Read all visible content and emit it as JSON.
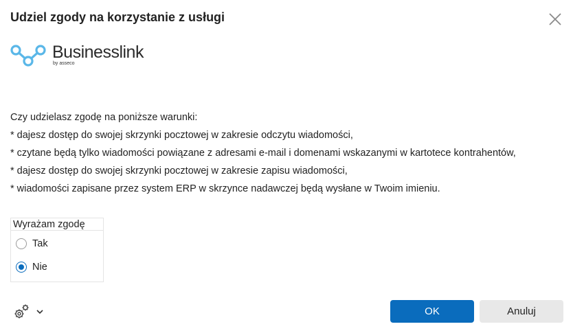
{
  "dialog": {
    "title": "Udziel zgody na korzystanie z usługi",
    "close_icon": "close-icon"
  },
  "logo": {
    "name": "Businesslink",
    "sub": "by asseco",
    "accent_color": "#5ab7e8"
  },
  "terms": {
    "intro": "Czy udzielasz zgodę na poniższe warunki:",
    "items": [
      "* dajesz dostęp do swojej skrzynki pocztowej w zakresie odczytu wiadomości,",
      "* czytane będą tylko wiadomości powiązane z adresami e-mail i domenami wskazanymi w kartotece kontrahentów,",
      "* dajesz dostęp do swojej skrzynki pocztowej w zakresie zapisu wiadomości,",
      "* wiadomości zapisane przez system ERP w skrzynce nadawczej będą wysłane w Twoim imieniu."
    ]
  },
  "consent": {
    "legend": "Wyrażam zgodę",
    "options": [
      {
        "label": "Tak",
        "checked": false
      },
      {
        "label": "Nie",
        "checked": true
      }
    ]
  },
  "footer": {
    "settings_icon": "gears-icon",
    "chevron_icon": "chevron-down-icon",
    "ok_label": "OK",
    "cancel_label": "Anuluj",
    "primary_color": "#0a6cbd"
  }
}
